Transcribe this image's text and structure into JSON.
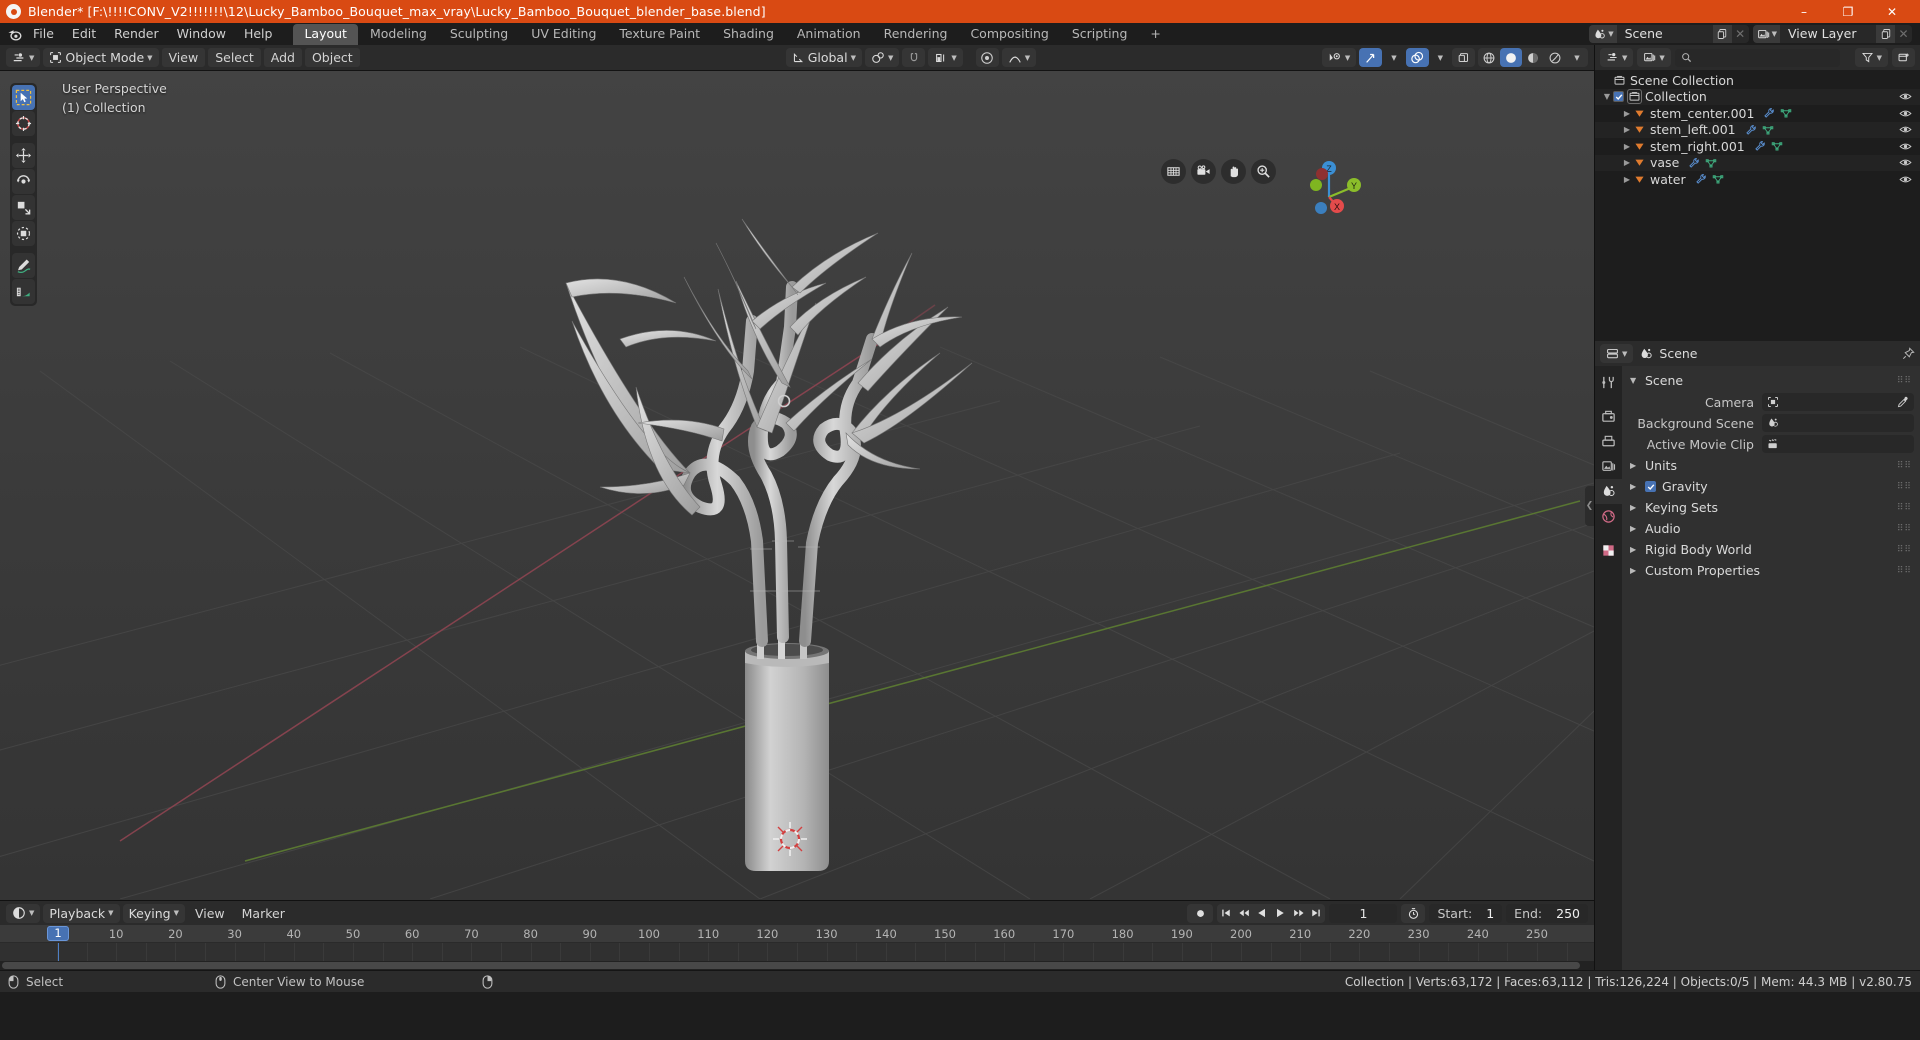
{
  "titlebar": {
    "title": "Blender* [F:\\!!!!CONV_V2!!!!!!!\\12\\Lucky_Bamboo_Bouquet_max_vray\\Lucky_Bamboo_Bouquet_blender_base.blend]",
    "minimize": "–",
    "maximize": "❐",
    "close": "✕",
    "accent": "#d94a13"
  },
  "menubar": {
    "items": [
      "File",
      "Edit",
      "Render",
      "Window",
      "Help"
    ],
    "workspaces": [
      {
        "label": "Layout",
        "active": true
      },
      {
        "label": "Modeling",
        "active": false
      },
      {
        "label": "Sculpting",
        "active": false
      },
      {
        "label": "UV Editing",
        "active": false
      },
      {
        "label": "Texture Paint",
        "active": false
      },
      {
        "label": "Shading",
        "active": false
      },
      {
        "label": "Animation",
        "active": false
      },
      {
        "label": "Rendering",
        "active": false
      },
      {
        "label": "Compositing",
        "active": false
      },
      {
        "label": "Scripting",
        "active": false
      }
    ],
    "add_workspace": "+",
    "scene_name": "Scene",
    "viewlayer_name": "View Layer"
  },
  "viewport_header": {
    "mode": "Object Mode",
    "menus": [
      "View",
      "Select",
      "Add",
      "Object"
    ],
    "transform_orientation": "Global"
  },
  "viewport": {
    "perspective_label": "User Perspective",
    "collection_label": "(1) Collection",
    "gizmo_axes": {
      "x": "X",
      "y": "Y",
      "z": "Z",
      "x_color": "#e44b4b",
      "y_color": "#8bbd2a",
      "z_color": "#3b8fd4"
    },
    "tools": [
      "select-box-tool",
      "cursor-tool",
      "move-tool",
      "rotate-tool",
      "scale-tool",
      "transform-tool",
      "annotate-tool",
      "measure-tool"
    ],
    "nav_buttons": [
      "zoom-region-icon",
      "camera-view-icon",
      "pan-view-icon",
      "zoom-view-icon"
    ]
  },
  "timeline": {
    "menus": [
      "Playback",
      "Keying",
      "View",
      "Marker"
    ],
    "current_frame": "1",
    "start_label": "Start:",
    "start_value": "1",
    "end_label": "End:",
    "end_value": "250",
    "ticks": [
      "10",
      "20",
      "30",
      "40",
      "50",
      "60",
      "70",
      "80",
      "90",
      "100",
      "110",
      "120",
      "130",
      "140",
      "150",
      "160",
      "170",
      "180",
      "190",
      "200",
      "210",
      "220",
      "230",
      "240",
      "250"
    ],
    "playhead_frame": "1"
  },
  "outliner": {
    "root": "Scene Collection",
    "collection": "Collection",
    "objects": [
      {
        "name": "stem_center.001"
      },
      {
        "name": "stem_left.001"
      },
      {
        "name": "stem_right.001"
      },
      {
        "name": "vase"
      },
      {
        "name": "water"
      }
    ]
  },
  "properties": {
    "breadcrumb": "Scene",
    "section_title": "Scene",
    "fields": [
      {
        "label": "Camera",
        "value": "",
        "icon": "camera-data-icon",
        "has_eyedropper": true
      },
      {
        "label": "Background Scene",
        "value": "",
        "icon": "scene-icon",
        "has_eyedropper": false
      },
      {
        "label": "Active Movie Clip",
        "value": "",
        "icon": "clip-icon",
        "has_eyedropper": false
      }
    ],
    "sections": [
      {
        "label": "Units",
        "checkbox": false
      },
      {
        "label": "Gravity",
        "checkbox": true
      },
      {
        "label": "Keying Sets",
        "checkbox": false
      },
      {
        "label": "Audio",
        "checkbox": false
      },
      {
        "label": "Rigid Body World",
        "checkbox": false
      },
      {
        "label": "Custom Properties",
        "checkbox": false
      }
    ]
  },
  "statusbar": {
    "hint_select": "Select",
    "hint_center": "Center View to Mouse",
    "stats": "Collection | Verts:63,172 | Faces:63,112 | Tris:126,224 | Objects:0/5 | Mem: 44.3 MB | v2.80.75"
  }
}
